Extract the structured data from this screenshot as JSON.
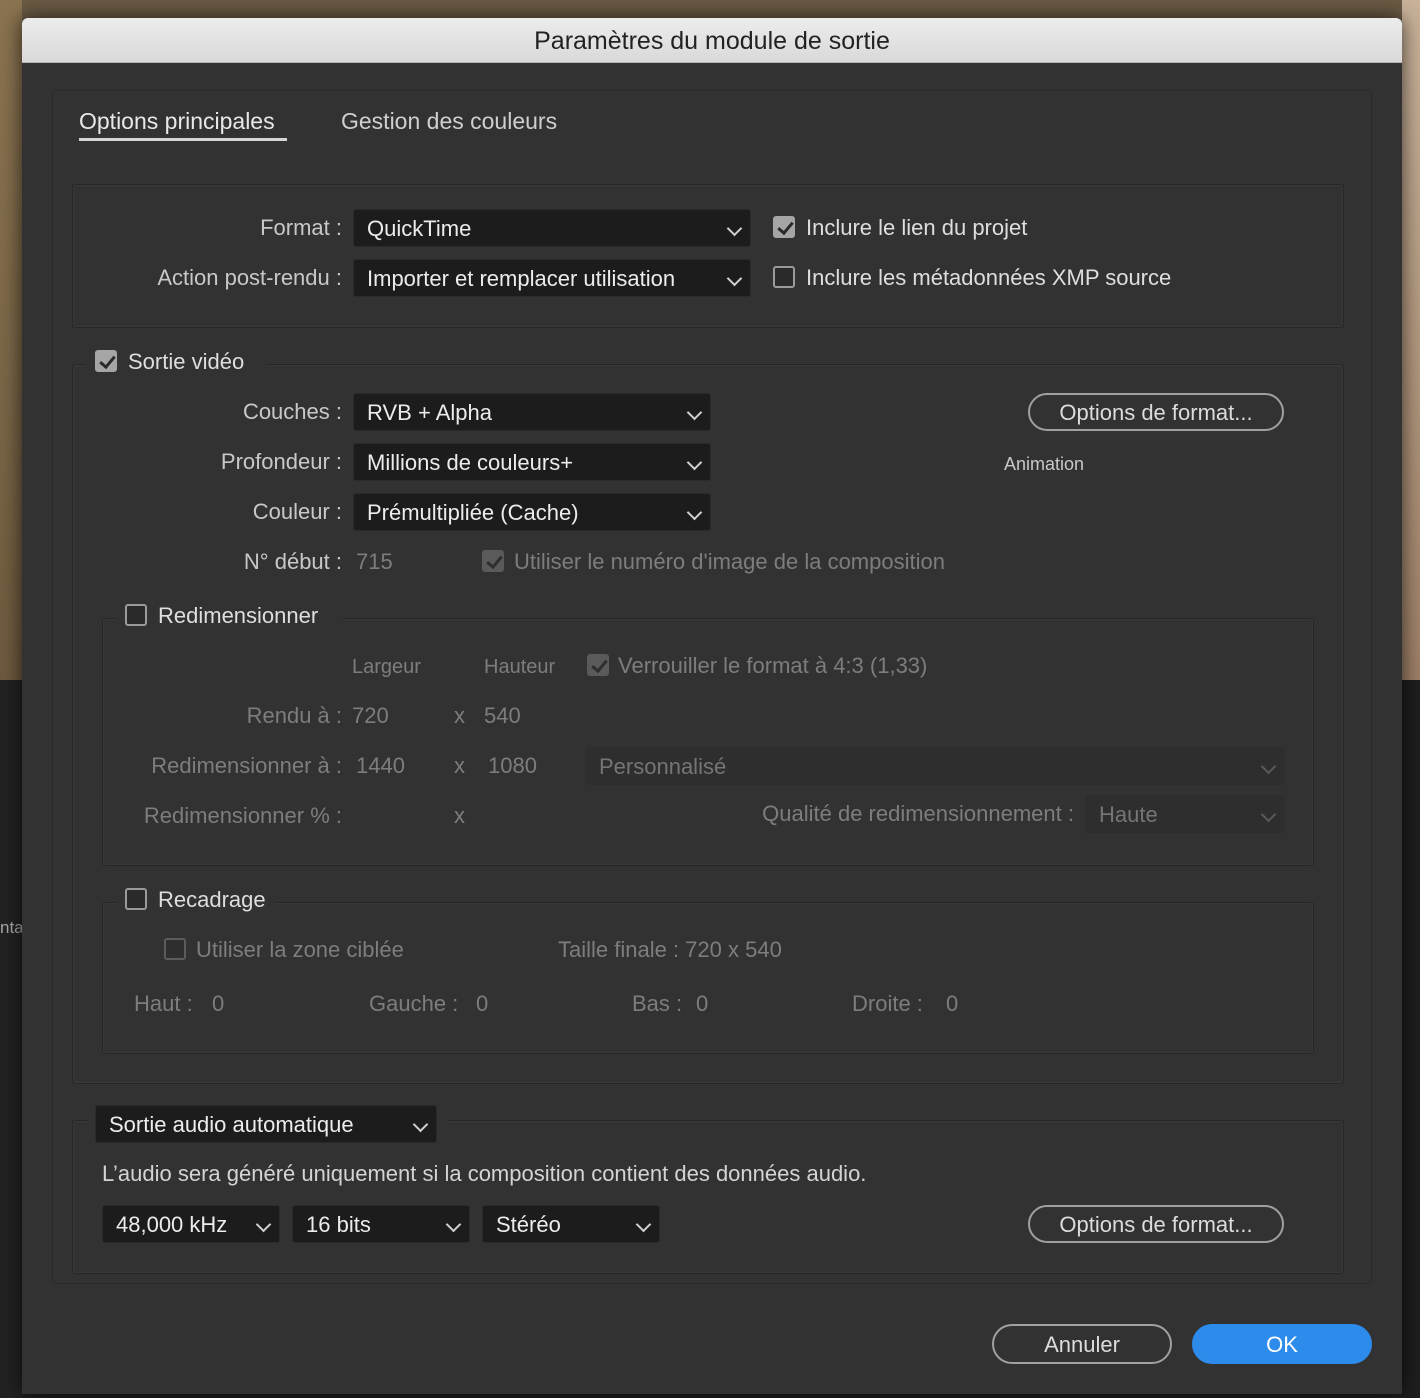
{
  "window": {
    "title": "Paramètres du module de sortie"
  },
  "background": {
    "left_text": "nta"
  },
  "tabs": [
    {
      "label": "Options principales",
      "active": true
    },
    {
      "label": "Gestion des couleurs",
      "active": false
    }
  ],
  "general": {
    "format_label": "Format :",
    "format_value": "QuickTime",
    "post_render_label": "Action post-rendu :",
    "post_render_value": "Importer et remplacer utilisation",
    "include_project_link": {
      "label": "Inclure le lien du projet",
      "checked": true
    },
    "include_xmp": {
      "label": "Inclure les métadonnées XMP source",
      "checked": false
    }
  },
  "video": {
    "section_label": "Sortie vidéo",
    "checked": true,
    "channels_label": "Couches :",
    "channels_value": "RVB + Alpha",
    "depth_label": "Profondeur :",
    "depth_value": "Millions de couleurs+",
    "color_label": "Couleur :",
    "color_value": "Prémultipliée (Cache)",
    "start_label": "N° début :",
    "start_value": "715",
    "use_comp_frame": {
      "label": "Utiliser le numéro d'image de la composition",
      "checked": true
    },
    "format_options_label": "Options de format...",
    "codec_label": "Animation"
  },
  "resize": {
    "section_label": "Redimensionner",
    "checked": false,
    "width_header": "Largeur",
    "height_header": "Hauteur",
    "lock_ratio": {
      "label": "Verrouiller le format à 4:3 (1,33)",
      "checked": true
    },
    "rendered_label": "Rendu à :",
    "rendered_w": "720",
    "rendered_h": "540",
    "resize_to_label": "Redimensionner à :",
    "resize_w": "1440",
    "resize_h": "1080",
    "preset_value": "Personnalisé",
    "resize_pct_label": "Redimensionner % :",
    "x_symbol": "x",
    "quality_label": "Qualité de redimensionnement :",
    "quality_value": "Haute"
  },
  "crop": {
    "section_label": "Recadrage",
    "checked": false,
    "use_roi": {
      "label": "Utiliser la zone ciblée",
      "checked": false
    },
    "final_size": "Taille finale : 720 x 540",
    "top_label": "Haut :",
    "top_value": "0",
    "left_label": "Gauche :",
    "left_value": "0",
    "bottom_label": "Bas :",
    "bottom_value": "0",
    "right_label": "Droite :",
    "right_value": "0"
  },
  "audio": {
    "mode_value": "Sortie audio automatique",
    "note": "L’audio sera généré uniquement si la composition contient des données audio.",
    "rate_value": "48,000 kHz",
    "bits_value": "16 bits",
    "channels_value": "Stéréo",
    "format_options_label": "Options de format..."
  },
  "footer": {
    "cancel_label": "Annuler",
    "ok_label": "OK"
  },
  "colors": {
    "accent": "#2d8ceb",
    "dialog_bg": "#323232"
  }
}
